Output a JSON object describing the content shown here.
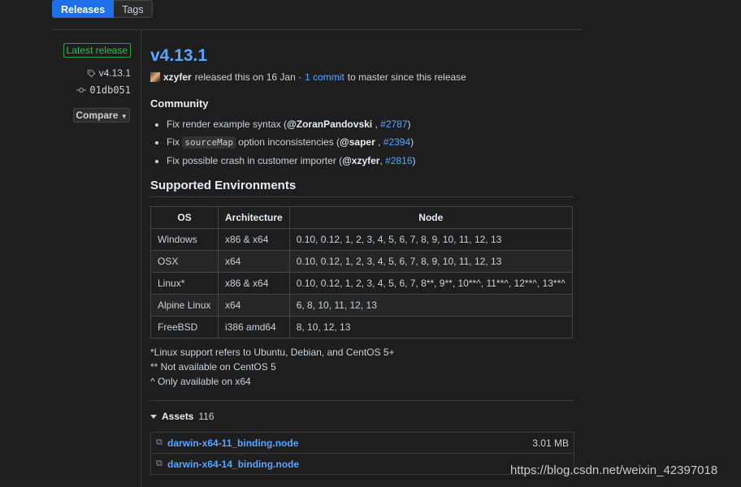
{
  "tabs": [
    {
      "label": "Releases",
      "active": true
    },
    {
      "label": "Tags",
      "active": false
    }
  ],
  "sidebar": {
    "latest_badge": "Latest release",
    "tag": "v4.13.1",
    "commit": "01db051",
    "compare_label": "Compare"
  },
  "release": {
    "title": "v4.13.1",
    "author": "xzyfer",
    "released_text": "released this on 16 Jan ·",
    "commit_link": "1 commit",
    "since_text": "to master since this release"
  },
  "community": {
    "heading": "Community",
    "items": [
      {
        "text": "Fix render example syntax (",
        "who": "@ZoranPandovski",
        "sep": " , ",
        "issue": "#2787",
        "end": ")"
      },
      {
        "pre": "Fix ",
        "code": "sourceMap",
        "text": " option inconsistencies (",
        "who": "@saper",
        "sep": " , ",
        "issue": "#2394",
        "end": ")"
      },
      {
        "text": "Fix possible crash in customer importer (",
        "who": "@xzyfer",
        "sep": ", ",
        "issue": "#2816",
        "end": ")"
      }
    ]
  },
  "environments": {
    "heading": "Supported Environments",
    "columns": [
      "OS",
      "Architecture",
      "Node"
    ],
    "rows": [
      [
        "Windows",
        "x86 & x64",
        "0.10, 0.12, 1, 2, 3, 4, 5, 6, 7, 8, 9, 10, 11, 12, 13"
      ],
      [
        "OSX",
        "x64",
        "0.10, 0.12, 1, 2, 3, 4, 5, 6, 7, 8, 9, 10, 11, 12, 13"
      ],
      [
        "Linux*",
        "x86 & x64",
        "0.10, 0.12, 1, 2, 3, 4, 5, 6, 7, 8**, 9**, 10**^, 11**^, 12**^, 13**^"
      ],
      [
        "Alpine Linux",
        "x64",
        "6, 8, 10, 11, 12, 13"
      ],
      [
        "FreeBSD",
        "i386 amd64",
        "8, 10, 12, 13"
      ]
    ],
    "notes": [
      "*Linux support refers to Ubuntu, Debian, and CentOS 5+",
      "** Not available on CentOS 5",
      "^ Only available on x64"
    ]
  },
  "assets": {
    "heading": "Assets",
    "count": "116",
    "items": [
      {
        "name": "darwin-x64-11_binding.node",
        "size": "3.01 MB"
      },
      {
        "name": "darwin-x64-14_binding.node",
        "size": ""
      }
    ]
  },
  "watermark": "https://blog.csdn.net/weixin_42397018",
  "colors": {
    "accent": "#58a6ff",
    "active_tab": "#1f6feb",
    "badge": "#3fb950",
    "background": "#1e1e1e"
  }
}
